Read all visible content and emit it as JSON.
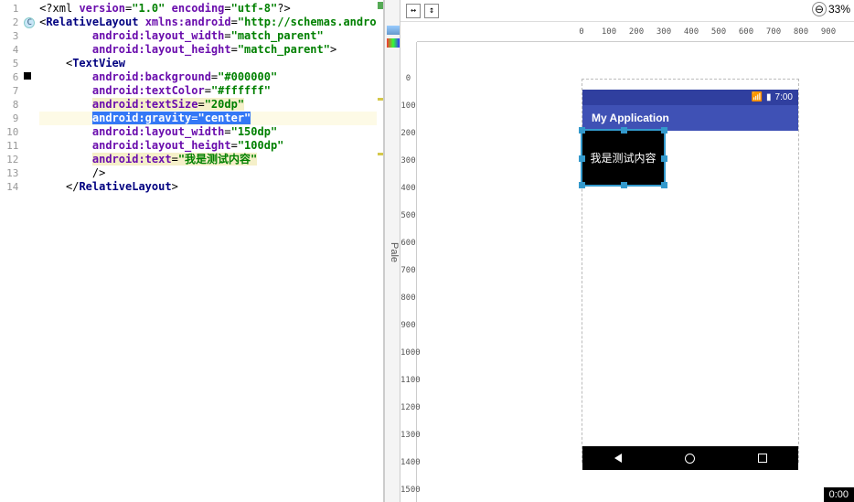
{
  "editor": {
    "lines": [
      {
        "n": 1,
        "parts": [
          {
            "t": "<?xml ",
            "c": ""
          },
          {
            "t": "version",
            "c": "attr"
          },
          {
            "t": "=",
            "c": ""
          },
          {
            "t": "\"1.0\"",
            "c": "val"
          },
          {
            "t": " ",
            "c": ""
          },
          {
            "t": "encoding",
            "c": "attr"
          },
          {
            "t": "=",
            "c": ""
          },
          {
            "t": "\"utf-8\"",
            "c": "val"
          },
          {
            "t": "?>",
            "c": ""
          }
        ],
        "indent": 0
      },
      {
        "n": 2,
        "parts": [
          {
            "t": "<",
            "c": ""
          },
          {
            "t": "RelativeLayout",
            "c": "tag"
          },
          {
            "t": " ",
            "c": ""
          },
          {
            "t": "xmlns:android",
            "c": "attr"
          },
          {
            "t": "=",
            "c": ""
          },
          {
            "t": "\"http://schemas.andro",
            "c": "val"
          }
        ],
        "indent": 0,
        "marker": "circle",
        "markerText": "C"
      },
      {
        "n": 3,
        "parts": [
          {
            "t": "android:layout_width",
            "c": "attr"
          },
          {
            "t": "=",
            "c": ""
          },
          {
            "t": "\"match_parent\"",
            "c": "val"
          }
        ],
        "indent": 2
      },
      {
        "n": 4,
        "parts": [
          {
            "t": "android:layout_height",
            "c": "attr"
          },
          {
            "t": "=",
            "c": ""
          },
          {
            "t": "\"match_parent\"",
            "c": "val"
          },
          {
            "t": ">",
            "c": ""
          }
        ],
        "indent": 2
      },
      {
        "n": 5,
        "parts": [
          {
            "t": "<",
            "c": ""
          },
          {
            "t": "TextView",
            "c": "tag"
          }
        ],
        "indent": 1
      },
      {
        "n": 6,
        "parts": [
          {
            "t": "android:background",
            "c": "attr"
          },
          {
            "t": "=",
            "c": ""
          },
          {
            "t": "\"#000000\"",
            "c": "val"
          }
        ],
        "indent": 2,
        "marker": "square"
      },
      {
        "n": 7,
        "parts": [
          {
            "t": "android:textColor",
            "c": "attr"
          },
          {
            "t": "=",
            "c": ""
          },
          {
            "t": "\"#ffffff\"",
            "c": "val"
          }
        ],
        "indent": 2
      },
      {
        "n": 8,
        "parts": [
          {
            "t": "android:textSize",
            "c": "attr warn"
          },
          {
            "t": "=",
            "c": "warn"
          },
          {
            "t": "\"20dp\"",
            "c": "val warn"
          }
        ],
        "indent": 2,
        "strip": "#d4c84a"
      },
      {
        "n": 9,
        "parts": [
          {
            "t": "android:gravity",
            "c": "attr sel"
          },
          {
            "t": "=",
            "c": "sel"
          },
          {
            "t": "\"center\"",
            "c": "val sel"
          }
        ],
        "indent": 2,
        "hl": true
      },
      {
        "n": 10,
        "parts": [
          {
            "t": "android:layout_width",
            "c": "attr"
          },
          {
            "t": "=",
            "c": ""
          },
          {
            "t": "\"150dp\"",
            "c": "val"
          }
        ],
        "indent": 2
      },
      {
        "n": 11,
        "parts": [
          {
            "t": "android:layout_height",
            "c": "attr"
          },
          {
            "t": "=",
            "c": ""
          },
          {
            "t": "\"100dp\"",
            "c": "val"
          }
        ],
        "indent": 2
      },
      {
        "n": 12,
        "parts": [
          {
            "t": "android:text",
            "c": "attr warn"
          },
          {
            "t": "=",
            "c": "warn"
          },
          {
            "t": "\"我是测试内容\"",
            "c": "val warn"
          }
        ],
        "indent": 2,
        "strip": "#d4c84a"
      },
      {
        "n": 13,
        "parts": [
          {
            "t": "/>",
            "c": ""
          }
        ],
        "indent": 2
      },
      {
        "n": 14,
        "parts": [
          {
            "t": "</",
            "c": ""
          },
          {
            "t": "RelativeLayout",
            "c": "tag"
          },
          {
            "t": ">",
            "c": ""
          }
        ],
        "indent": 1
      }
    ]
  },
  "palette": {
    "label": "Pale"
  },
  "toolbar": {
    "btn1": "↔",
    "btn2": "↕"
  },
  "zoom": {
    "value": "33%",
    "icon": "⊖"
  },
  "ruler_h": [
    "0",
    "100",
    "200",
    "300",
    "400",
    "500",
    "600",
    "700",
    "800",
    "900"
  ],
  "ruler_v": [
    "0",
    "100",
    "200",
    "300",
    "400",
    "500",
    "600",
    "700",
    "800",
    "900",
    "1000",
    "1100",
    "1200",
    "1300",
    "1400",
    "1500"
  ],
  "device": {
    "status_time": "7:00",
    "wifi": "📶",
    "battery": "▮",
    "app_title": "My Application",
    "tv_text": "我是测试内容"
  },
  "timer": "0:00"
}
